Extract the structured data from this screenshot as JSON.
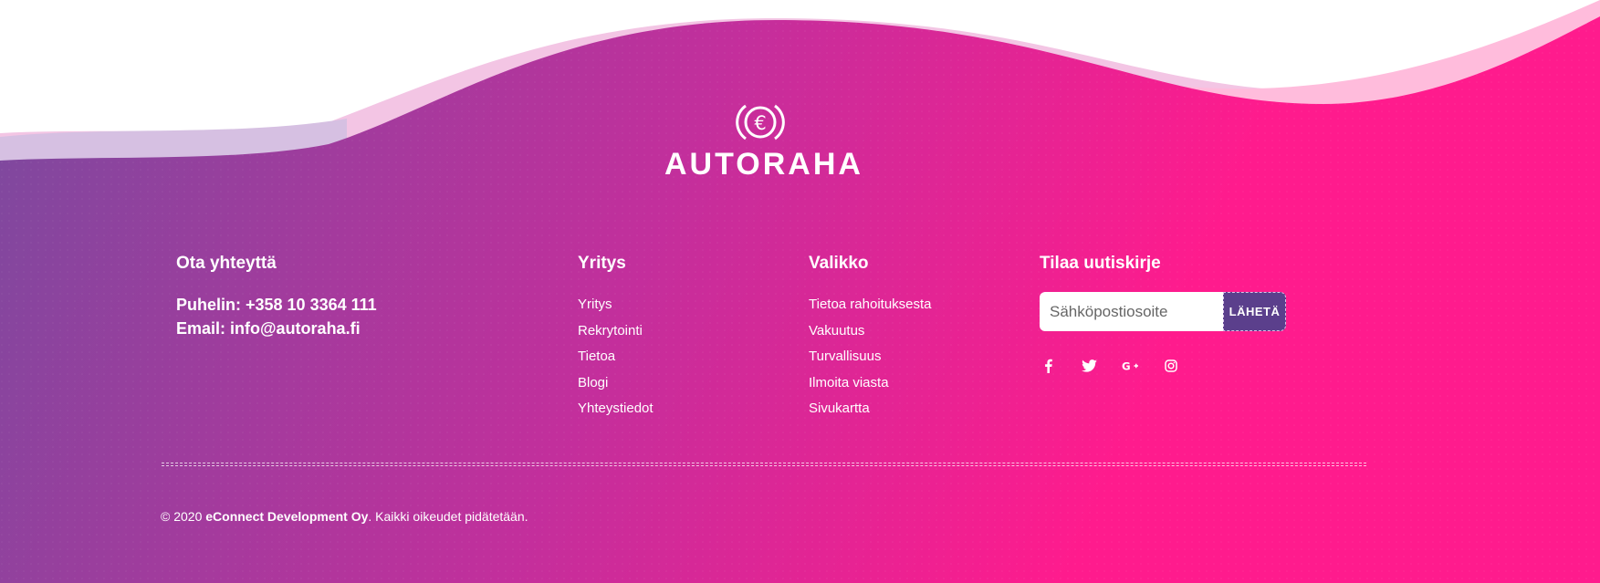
{
  "brand": {
    "name": "AUTORAHA",
    "logo_icon": "euro-coin-icon",
    "logo_symbol": "€"
  },
  "colors": {
    "gradient_start": "#7a4a9e",
    "gradient_mid": "#c22f9c",
    "gradient_end": "#ff1b8d",
    "wave_light_left": "#d6c0e2",
    "wave_light_right": "#ffbcdc",
    "button_bg": "#5b3f8c"
  },
  "contact": {
    "heading": "Ota yhteyttä",
    "phone": "Puhelin: +358 10 3364 111",
    "email": "Email: info@autoraha.fi"
  },
  "company": {
    "heading": "Yritys",
    "items": [
      "Yritys",
      "Rekrytointi",
      "Tietoa",
      "Blogi",
      "Yhteystiedot"
    ]
  },
  "menu": {
    "heading": "Valikko",
    "items": [
      "Tietoa rahoituksesta",
      "Vakuutus",
      "Turvallisuus",
      "Ilmoita viasta",
      "Sivukartta"
    ]
  },
  "newsletter": {
    "heading": "Tilaa uutiskirje",
    "placeholder": "Sähköpostiosoite",
    "value": "",
    "button": "LÄHETÄ"
  },
  "social": [
    "facebook-icon",
    "twitter-icon",
    "google-plus-icon",
    "instagram-icon"
  ],
  "footer": {
    "copyright_prefix": "© 2020 ",
    "company": "eConnect Development Oy",
    "rights": ". Kaikki oikeudet pidätetään."
  }
}
